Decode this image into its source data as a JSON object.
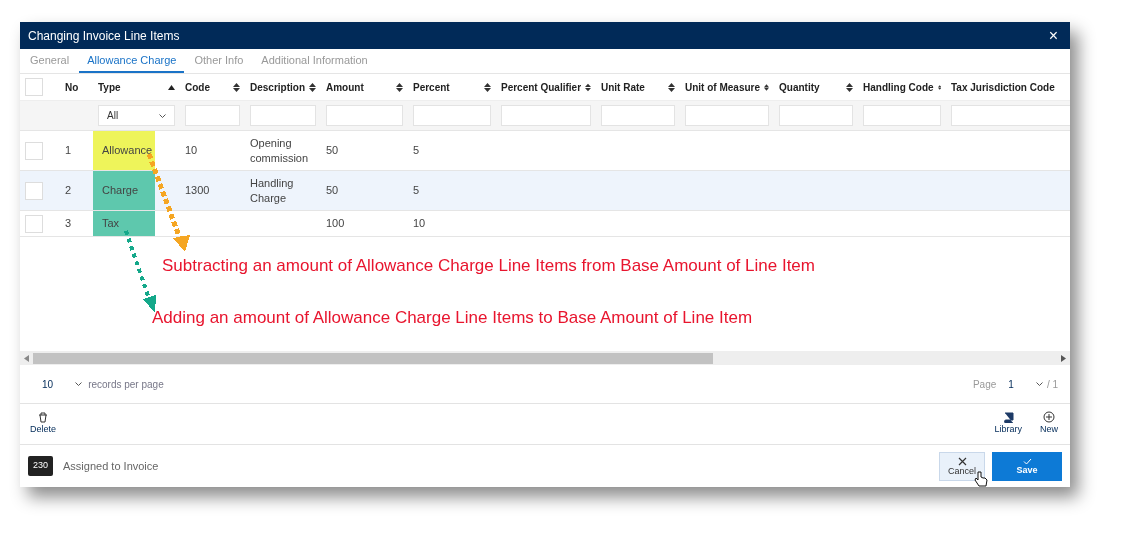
{
  "window": {
    "title": "Changing Invoice Line Items",
    "close": "×"
  },
  "tabs": [
    {
      "label": "General",
      "selected": false
    },
    {
      "label": "Allowance Charge",
      "selected": true
    },
    {
      "label": "Other Info",
      "selected": false
    },
    {
      "label": "Additional Information",
      "selected": false
    }
  ],
  "table": {
    "select_all_checked": false,
    "columns": [
      {
        "label": "No"
      },
      {
        "label": "Type",
        "sorted": true
      },
      {
        "label": "Code",
        "sorted": false
      },
      {
        "label": "Description",
        "sorted": false
      },
      {
        "label": "Amount",
        "sorted": false
      },
      {
        "label": "Percent",
        "sorted": false
      },
      {
        "label": "Percent Qualifier",
        "sorted": false
      },
      {
        "label": "Unit Rate",
        "sorted": false
      },
      {
        "label": "Unit of Measure",
        "sorted": false
      },
      {
        "label": "Quantity",
        "sorted": false
      },
      {
        "label": "Handling Code",
        "sorted": false
      },
      {
        "label": "Tax Jurisdiction Code"
      }
    ],
    "type_filter": "All",
    "rows": [
      {
        "no": "1",
        "type": "Allowance",
        "color": "#eef45a",
        "code": "10",
        "description": "Opening commission",
        "amount": "50",
        "percent": "5",
        "selected": false,
        "checked": false
      },
      {
        "no": "2",
        "type": "Charge",
        "color": "#5ec8ad",
        "code": "1300",
        "description": "Handling Charge",
        "amount": "50",
        "percent": "5",
        "selected": true,
        "checked": false
      },
      {
        "no": "3",
        "type": "Tax",
        "color": "#5ec8ad",
        "amount": "100",
        "percent": "10",
        "selected": false,
        "checked": false
      }
    ]
  },
  "annotations": [
    {
      "text": "Subtracting an amount of Allowance Charge Line Items from Base Amount of Line Item",
      "color": "#f5a623"
    },
    {
      "text": "Adding an amount of Allowance Charge Line Items to Base Amount of Line Item",
      "color": "#14a88a"
    }
  ],
  "pager": {
    "page_size": "10",
    "records_label": "records per page",
    "page_label": "Page",
    "page": "1",
    "total": "/ 1"
  },
  "toolbar": {
    "delete": "Delete",
    "library": "Library",
    "new": "New"
  },
  "footer": {
    "badge": "230",
    "status": "Assigned to Invoice",
    "cancel": "Cancel",
    "save": "Save"
  }
}
